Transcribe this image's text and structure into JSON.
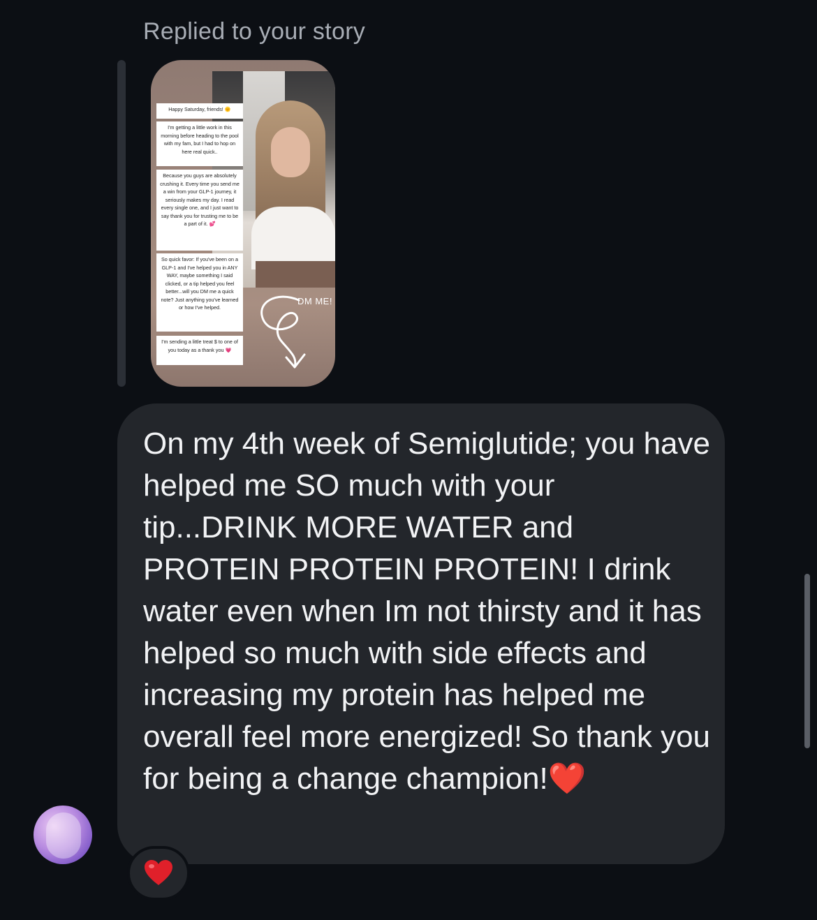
{
  "header": {
    "replied_label": "Replied to your story"
  },
  "story": {
    "notes": [
      "Happy Saturday, friends! 🌞",
      "I'm getting a little work in this morning before heading to the pool with my fam, but I had to hop on here real quick..",
      "Because you guys are absolutely crushing it. Every time you send me a win from your GLP-1 journey, it seriously makes my day. I read every single one, and I just want to say thank you for trusting me to be a part of it. 💕",
      "So quick favor: If you've been on a GLP-1 and I've helped you in ANY WAY, maybe something I said clicked, or a tip helped you feel better...will you DM me a quick note? Just anything you've learned or how I've helped.",
      "I'm sending a little treat $ to one of you today as a thank you 💗"
    ],
    "dm_label": "DM ME!"
  },
  "message": {
    "text": "On my 4th week of Semiglutide; you have helped me SO much with your tip...DRINK MORE WATER and PROTEIN PROTEIN PROTEIN! I drink water even when Im not thirsty and it has helped so much with side effects and increasing my protein has helped me overall feel more energized! So thank you for being a change champion!",
    "emoji": "❤️"
  },
  "reaction": {
    "emoji": "❤️"
  },
  "colors": {
    "background": "#0c0f14",
    "bubble": "#23262b",
    "secondary_text": "#a8adb5",
    "heart": "#e0202a"
  }
}
